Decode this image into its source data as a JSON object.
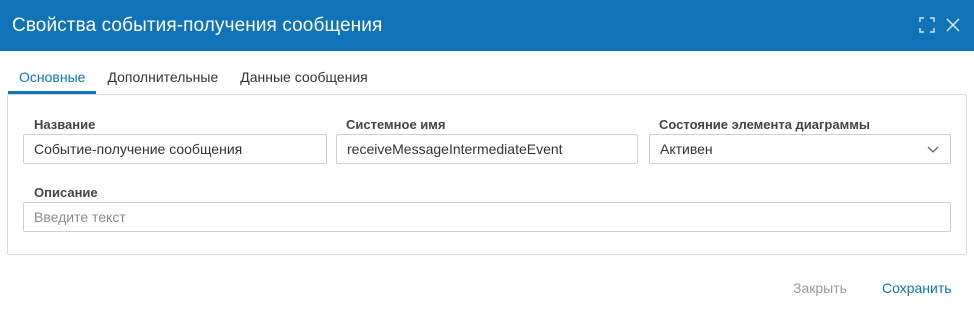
{
  "dialog": {
    "title": "Свойства события-получения сообщения"
  },
  "icons": {
    "maximize": "maximize-icon",
    "close": "close-icon",
    "dropdown": "chevron-down-icon"
  },
  "tabs": [
    {
      "label": "Основные",
      "active": true
    },
    {
      "label": "Дополнительные",
      "active": false
    },
    {
      "label": "Данные сообщения",
      "active": false
    }
  ],
  "form": {
    "name": {
      "label": "Название",
      "value": "Событие-получение сообщения"
    },
    "system_name": {
      "label": "Системное имя",
      "value": "receiveMessageIntermediateEvent"
    },
    "state": {
      "label": "Состояние элемента диаграммы",
      "value": "Активен"
    },
    "description": {
      "label": "Описание",
      "value": "",
      "placeholder": "Введите текст"
    }
  },
  "footer": {
    "close_label": "Закрыть",
    "save_label": "Сохранить"
  },
  "colors": {
    "accent": "#0f73b8",
    "header_bg": "#0f73b8",
    "disabled_text": "#9a9a9a"
  }
}
